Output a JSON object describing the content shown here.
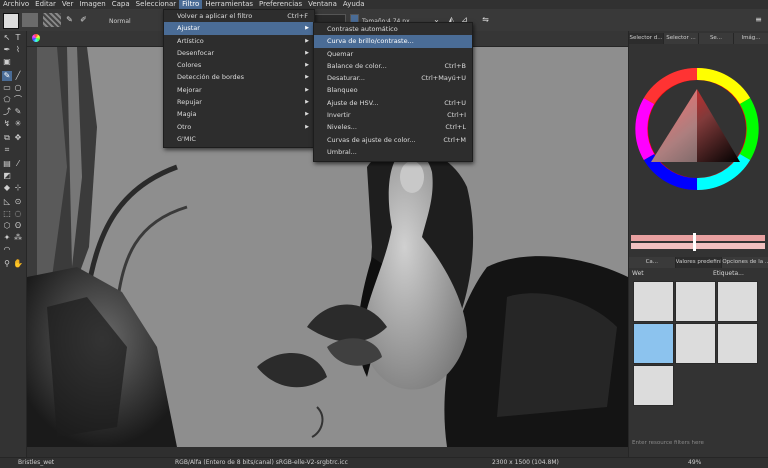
{
  "menubar": [
    "Archivo",
    "Editar",
    "Ver",
    "Imagen",
    "Capa",
    "Seleccionar",
    "Filtro",
    "Herramientas",
    "Preferencias",
    "Ventana",
    "Ayuda"
  ],
  "toolbar": {
    "blend_mode": "Normal",
    "size_label": "Tamaño:",
    "size_value": "4,74 px"
  },
  "filter_menu": {
    "reapply": "Volver a aplicar el filtro",
    "reapply_shortcut": "Ctrl+F",
    "items": [
      "Ajustar",
      "Artístico",
      "Desenfocar",
      "Colores",
      "Detección de bordes",
      "Mejorar",
      "Repujar",
      "Magia",
      "Otro"
    ],
    "gmic": "G'MIC"
  },
  "adjust_menu": [
    {
      "label": "Contraste automático",
      "shortcut": ""
    },
    {
      "label": "Curva de brillo/contraste...",
      "shortcut": ""
    },
    {
      "label": "Quemar",
      "shortcut": ""
    },
    {
      "label": "Balance de color...",
      "shortcut": "Ctrl+B"
    },
    {
      "label": "Desaturar...",
      "shortcut": "Ctrl+Mayú+U"
    },
    {
      "label": "Blanqueo",
      "shortcut": ""
    },
    {
      "label": "Ajuste de HSV...",
      "shortcut": "Ctrl+U"
    },
    {
      "label": "Invertir",
      "shortcut": "Ctrl+I"
    },
    {
      "label": "Niveles...",
      "shortcut": "Ctrl+L"
    },
    {
      "label": "Curvas de ajuste de color...",
      "shortcut": "Ctrl+M"
    },
    {
      "label": "Umbral...",
      "shortcut": ""
    }
  ],
  "right_panel": {
    "top_tabs": [
      "Selector d...",
      "Selector ...",
      "Se...",
      "Imág..."
    ],
    "mid_tabs": [
      "Ca...",
      "Valores predefini...",
      "Opciones de la ..."
    ],
    "brush_tag": "Wet",
    "tag_label": "Etiqueta...",
    "filter_placeholder": "Enter resource filters here"
  },
  "status": {
    "brush": "Bristles_wet",
    "color": "RGB/Alfa (Entero de 8 bits/canal)  sRGB-elle-V2-srgbtrc.icc",
    "dimensions": "2300 x 1500 (104.8M)",
    "zoom": "49%"
  },
  "colors": {
    "highlight": "#4a6c96",
    "canvas_bg": "#8e8e8e",
    "brush_selected": "#8cc3ee"
  }
}
